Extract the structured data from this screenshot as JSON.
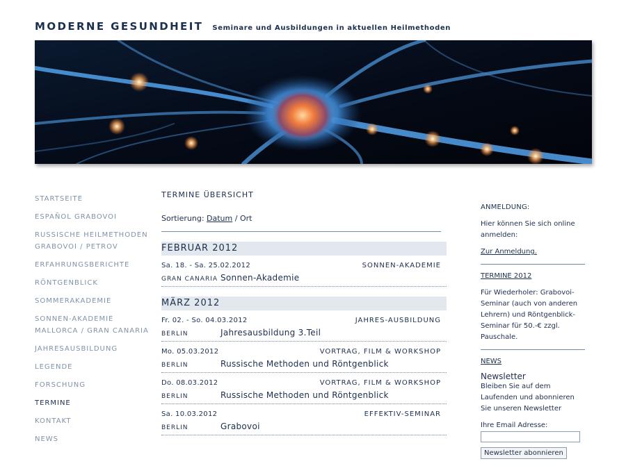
{
  "header": {
    "title": "MODERNE GESUNDHEIT",
    "tagline": "Seminare und Ausbildungen in aktuellen Heilmethoden"
  },
  "banner": {
    "image": "neuron-illustration",
    "colors": {
      "background": "#03060d",
      "cell": "#5fa8e6",
      "nucleus": "#f07c3c"
    }
  },
  "nav": {
    "items": [
      {
        "label": "STARTSEITE"
      },
      {
        "label": "ESPAÑOL GRABOVOI"
      },
      {
        "label": "RUSSISCHE HEILMETHODEN",
        "label2": "GRABOVOI / PETROV"
      },
      {
        "label": "ERFAHRUNGSBERICHTE"
      },
      {
        "label": "RÖNTGENBLICK"
      },
      {
        "label": "SOMMERAKADEMIE"
      },
      {
        "label": "SONNEN-AKADEMIE",
        "label2": "MALLORCA / GRAN CANARIA"
      },
      {
        "label": "JAHRESAUSBILDUNG"
      },
      {
        "label": "LEGENDE"
      },
      {
        "label": "FORSCHUNG"
      },
      {
        "label": "TERMINE",
        "active": true
      },
      {
        "label": "KONTAKT"
      },
      {
        "label": "NEWS"
      }
    ]
  },
  "main": {
    "title": "TERMINE ÜBERSICHT",
    "sort": {
      "label": "Sortierung:",
      "option1": "Datum",
      "separator": "/",
      "option2": "Ort"
    },
    "months": [
      {
        "name": "FEBRUAR 2012",
        "events": [
          {
            "date": "Sa. 18. - Sa. 25.02.2012",
            "category": "SONNEN-AKADEMIE",
            "location": "GRAN CANARIA",
            "title": "Sonnen-Akademie"
          }
        ]
      },
      {
        "name": "MÄRZ 2012",
        "events": [
          {
            "date": "Fr. 02. - So. 04.03.2012",
            "category": "JAHRES-AUSBILDUNG",
            "location": "BERLIN",
            "title": "Jahresausbildung 3.Teil"
          },
          {
            "date": "Mo. 05.03.2012",
            "category": "VORTRAG, FILM & WORKSHOP",
            "location": "BERLIN",
            "title": "Russische Methoden und Röntgenblick"
          },
          {
            "date": "Do. 08.03.2012",
            "category": "VORTRAG, FILM & WORKSHOP",
            "location": "BERLIN",
            "title": "Russische Methoden und Röntgenblick"
          },
          {
            "date": "Sa. 10.03.2012",
            "category": "EFFEKTIV-SEMINAR",
            "location": "BERLIN",
            "title": "Grabovoi"
          }
        ]
      }
    ]
  },
  "sidebar": {
    "anmeldung_head": "ANMELDUNG:",
    "anmeldung_text": "Hier können Sie sich online anmelden:",
    "anmeldung_link": "Zur Anmeldung.",
    "termine_link": "TERMINE 2012",
    "termine_text": "Für Wiederholer: Grabovoi-Seminar (auch von anderen Lehrern) und Röntgenblick-Seminar für 50.-€ zzgl. Pauschale.",
    "news_link": "NEWS",
    "newsletter_title": "Newsletter",
    "newsletter_text": "Bleiben Sie auf dem Laufenden und abonnieren Sie unseren Newsletter",
    "email_label": "Ihre Email Adresse:",
    "email_value": "",
    "button": "Newsletter abonnieren"
  }
}
